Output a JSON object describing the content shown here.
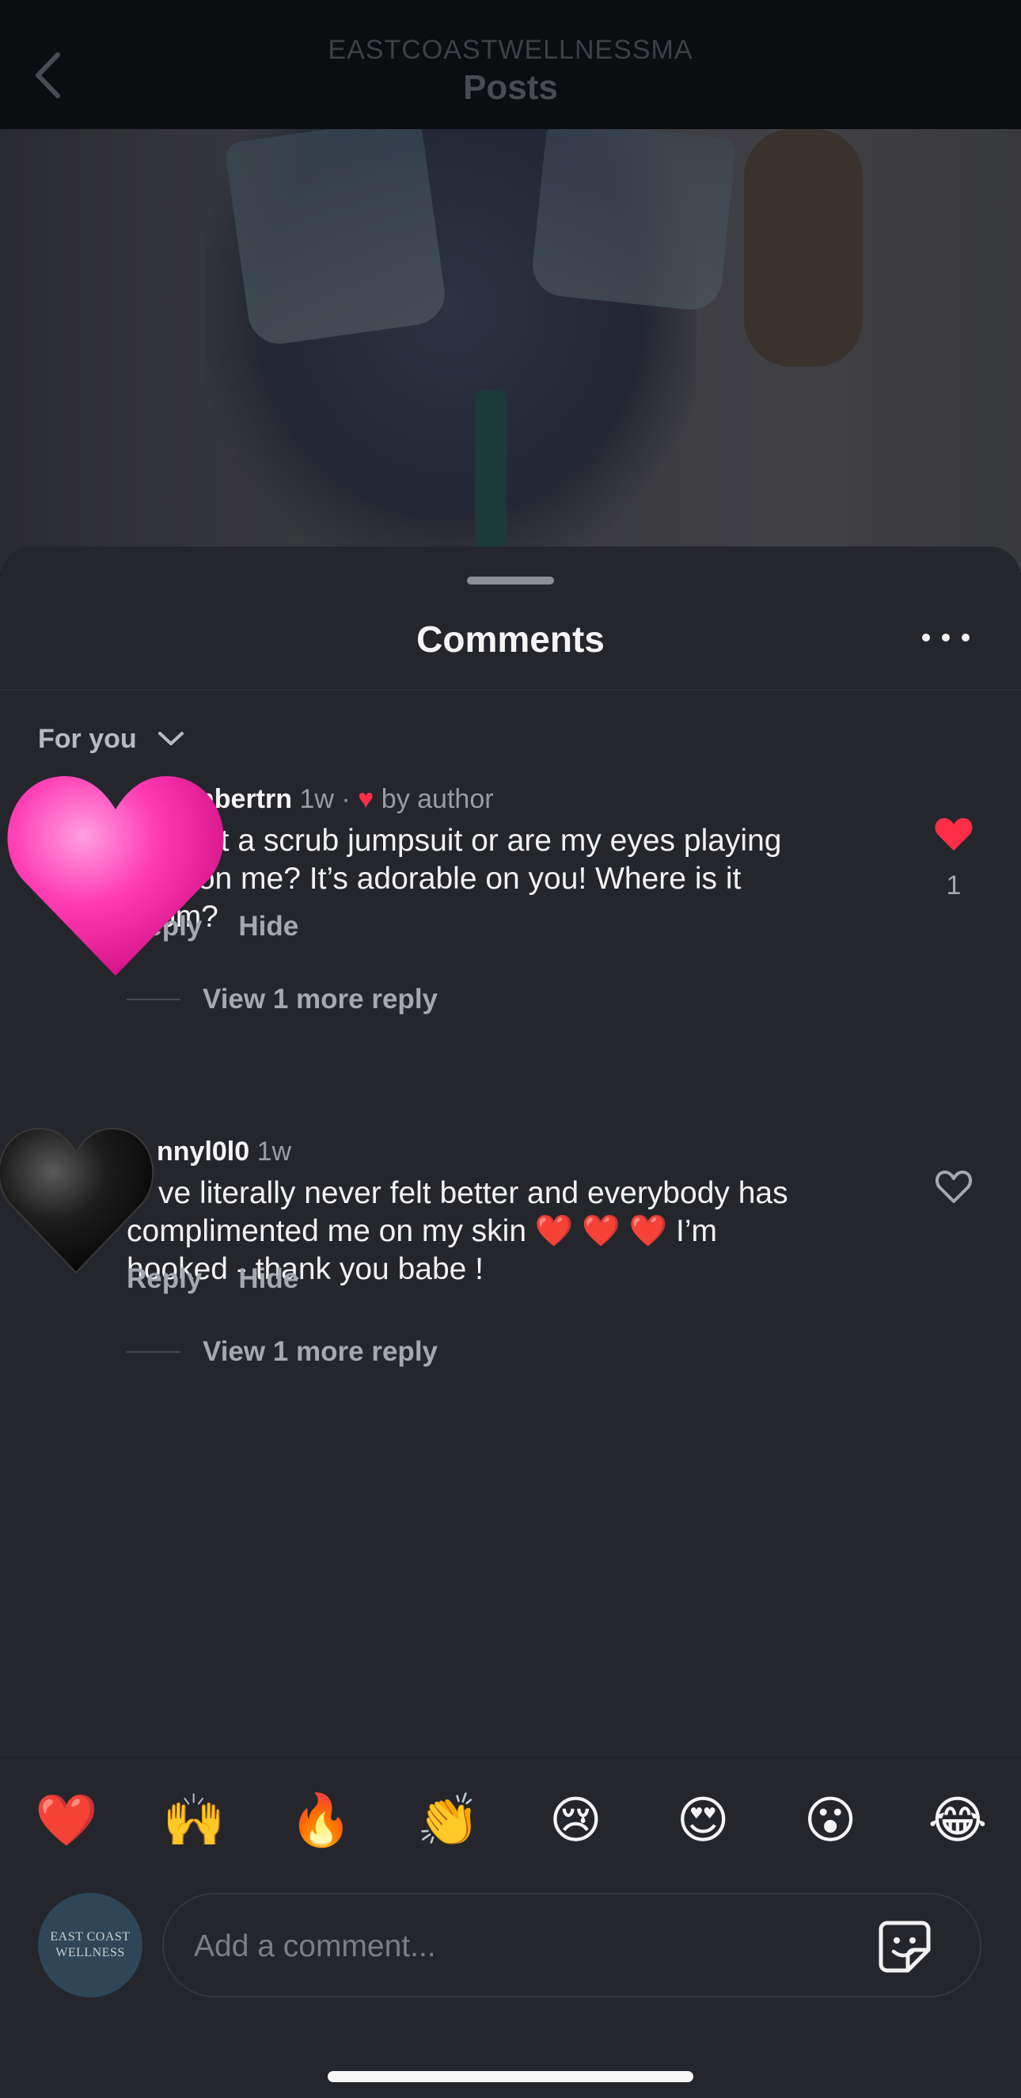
{
  "header": {
    "subtitle": "EASTCOASTWELLNESSMA",
    "title": "Posts"
  },
  "sheet": {
    "title": "Comments",
    "filter_label": "For you"
  },
  "comments": [
    {
      "username": "nbertrn",
      "time": "1w",
      "badge": "by author",
      "text": "...t a scrub jumpsuit or are my eyes playing ...ks on me? It’s adorable on you! Where is it ...om?",
      "line1": "it a scrub jumpsuit or are my eyes playing",
      "line2": "ks on me? It’s adorable on you! Where is it",
      "line3": "om?",
      "reply_label": "Reply",
      "hide_label": "Hide",
      "view_more_label": "View 1 more reply",
      "likes": "1",
      "liked": true,
      "avatar_icon": "pink-heart-icon"
    },
    {
      "username": "nnyl0l0",
      "time": "1w",
      "line1": "ve literally never felt better and everybody has",
      "line2": "complimented me on my skin ❤️ ❤️ ❤️ I’m",
      "line3": "hooked - thank you babe !",
      "reply_label": "Reply",
      "hide_label": "Hide",
      "view_more_label": "View 1 more reply",
      "liked": false,
      "avatar_icon": "black-heart-icon"
    }
  ],
  "emoji_bar": [
    "❤️",
    "🙌",
    "🔥",
    "👏",
    "😢",
    "😍",
    "😮",
    "😂"
  ],
  "composer": {
    "placeholder": "Add a comment...",
    "avatar_line1": "EAST COAST",
    "avatar_line2": "WELLNESS"
  },
  "colors": {
    "sheet_bg": "#24262c",
    "like_red": "#ff2d46",
    "avatar_pink": "#ff3cb4"
  }
}
